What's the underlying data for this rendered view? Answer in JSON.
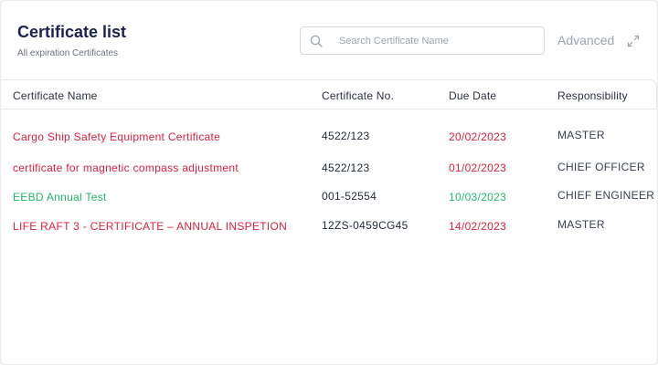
{
  "header": {
    "title": "Certificate list",
    "subtitle": "All expiration Certificates"
  },
  "search": {
    "placeholder": "Search Certificate Name",
    "value": "",
    "icon": "search-icon"
  },
  "advanced": {
    "label": "Advanced",
    "icon": "expand-icon"
  },
  "table": {
    "columns": [
      "Certificate Name",
      "Certificate No.",
      "Due Date",
      "Responsibility"
    ],
    "rows": [
      {
        "name": "Cargo Ship Safety Equipment Certificate",
        "number": "4522/123",
        "due": "20/02/2023",
        "responsibility": "MASTER",
        "status": "expired"
      },
      {
        "name": "certificate for magnetic compass adjustment",
        "number": "4522/123",
        "due": "01/02/2023",
        "responsibility": "CHIEF OFFICER",
        "status": "expired"
      },
      {
        "name": "EEBD Annual Test",
        "number": "001-52554",
        "due": "10/03/2023",
        "responsibility": "CHIEF ENGINEER",
        "status": "valid"
      },
      {
        "name": "LIFE RAFT 3 - CERTIFICATE – ANNUAL INSPETION",
        "number": "12ZS-0459CG45",
        "due": "14/02/2023",
        "responsibility": "MASTER",
        "status": "expired"
      }
    ]
  },
  "colors": {
    "title": "#1b2350",
    "expired": "#dc1f3c",
    "valid": "#22b86a"
  }
}
